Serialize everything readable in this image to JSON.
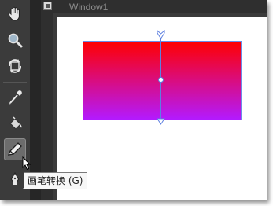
{
  "window": {
    "title": "Window1"
  },
  "toolbar": {
    "tools": [
      {
        "id": "hand",
        "icon": "hand-icon"
      },
      {
        "id": "zoom",
        "icon": "magnifier-icon"
      },
      {
        "id": "transform",
        "icon": "rotate-icon"
      },
      {
        "id": "eyedropper",
        "icon": "eyedropper-icon"
      },
      {
        "id": "fill",
        "icon": "paint-bucket-icon"
      },
      {
        "id": "brush-transform",
        "icon": "brush-transform-icon",
        "active": true
      },
      {
        "id": "pen",
        "icon": "pen-nib-icon"
      }
    ]
  },
  "tooltip": {
    "text": "画笔转换 (G)"
  },
  "canvas": {
    "gradient": {
      "top_color": "#ff0000",
      "bottom_color": "#b31aff",
      "handle_color": "#5d7fe0"
    }
  }
}
